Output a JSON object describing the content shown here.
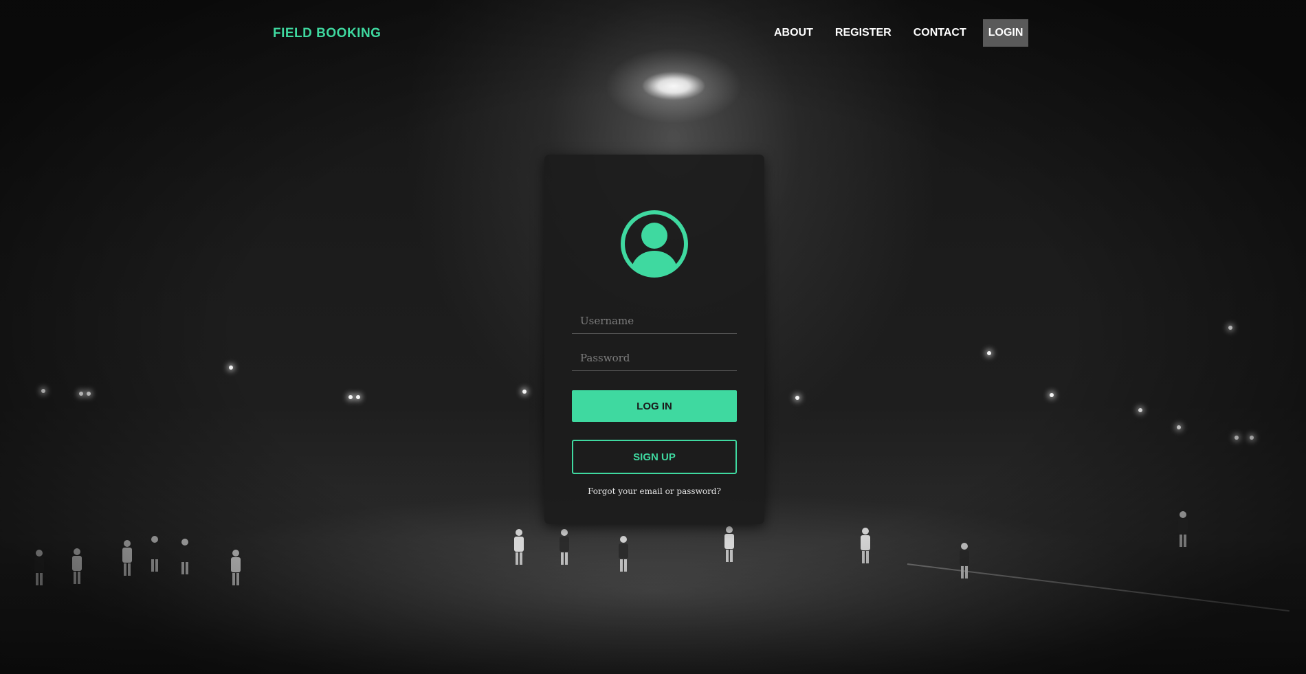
{
  "colors": {
    "accent": "#3fd9a0",
    "nav_active_bg": "#5a5a5a",
    "card_bg": "#1c1c1c"
  },
  "navbar": {
    "brand": "FIELD BOOKING",
    "links": [
      {
        "label": "ABOUT"
      },
      {
        "label": "REGISTER"
      },
      {
        "label": "CONTACT"
      },
      {
        "label": "LOGIN"
      }
    ]
  },
  "login": {
    "avatar_icon": "user-circle-icon",
    "username_placeholder": "Username",
    "password_placeholder": "Password",
    "login_button": "LOG IN",
    "signup_button": "SIGN UP",
    "forgot_link": "Forgot your email or password?"
  },
  "background": {
    "description_icon": "night-football-field-image"
  }
}
